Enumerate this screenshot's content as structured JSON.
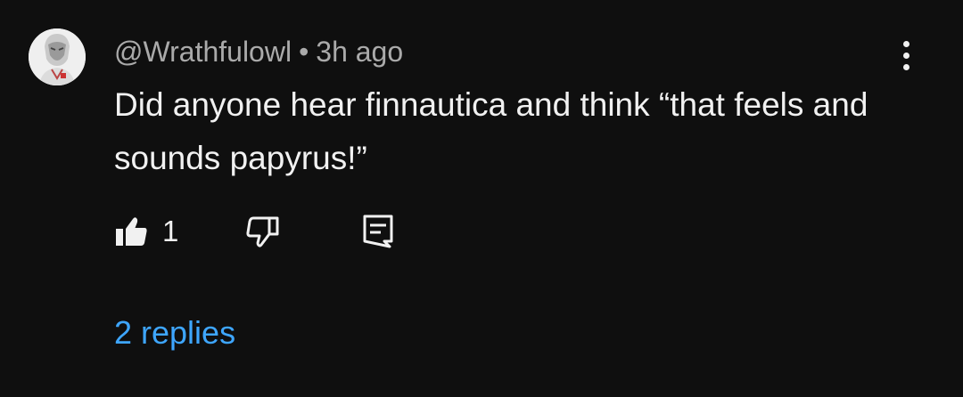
{
  "comment": {
    "author": "@Wrathfulowl",
    "separator": "•",
    "time": "3h ago",
    "text": "Did anyone hear finnautica and think “that feels and sounds papyrus!”",
    "like_count": "1",
    "replies_label": "2 replies"
  },
  "icons": {
    "avatar": "avatar",
    "like": "thumbs-up-icon",
    "dislike": "thumbs-down-icon",
    "reply": "reply-comment-icon",
    "menu": "more-vertical-icon"
  },
  "colors": {
    "background": "#0f0f0f",
    "text": "#f1f1f1",
    "secondary_text": "#aaaaaa",
    "link": "#3ea6ff"
  }
}
